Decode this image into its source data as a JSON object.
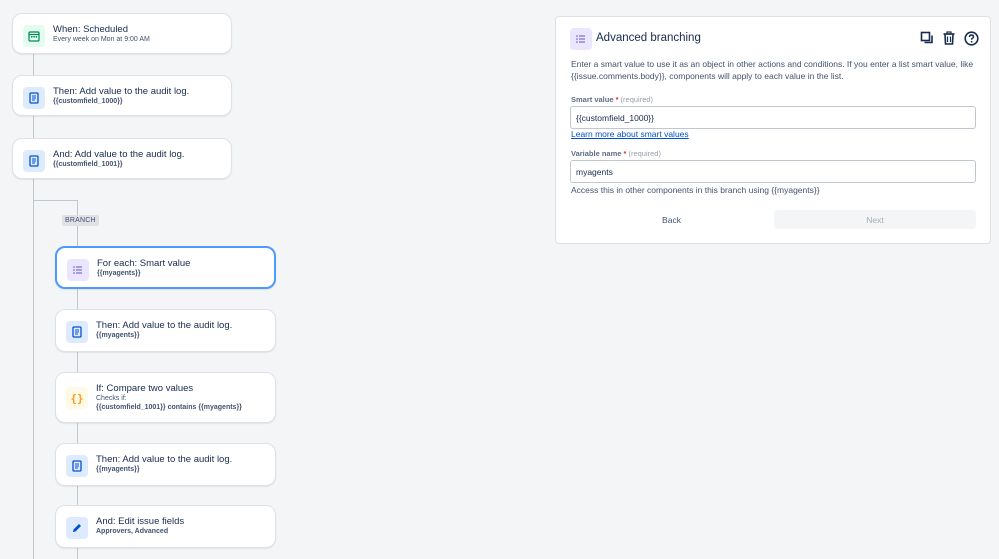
{
  "flow": {
    "trigger": {
      "title": "When: Scheduled",
      "subtitle": "Every week on Mon at 9:00 AM",
      "icon": "calendar-icon"
    },
    "step1": {
      "title": "Then: Add value to the audit log.",
      "subtitle": "{{customfield_1000}}",
      "icon": "document-icon"
    },
    "step2": {
      "title": "And: Add value to the audit log.",
      "subtitle": "{{customfield_1001}}",
      "icon": "document-icon"
    },
    "branch_label": "BRANCH",
    "branch": [
      {
        "title": "For each: Smart value",
        "subtitle": "{{myagents}}",
        "icon": "list-icon"
      },
      {
        "title": "Then: Add value to the audit log.",
        "subtitle": "{{myagents}}",
        "icon": "document-icon"
      },
      {
        "title": "If: Compare two values",
        "subtitle": "Checks if:",
        "subtitle2": "{{customfield_1001}} contains {{myagents}}",
        "icon": "braces-icon"
      },
      {
        "title": "Then: Add value to the audit log.",
        "subtitle": "{{myagents}}",
        "icon": "document-icon"
      },
      {
        "title": "And: Edit issue fields",
        "subtitle": "Approvers, Advanced",
        "icon": "pencil-icon"
      }
    ]
  },
  "panel": {
    "title": "Advanced branching",
    "icon": "list-icon",
    "actions": [
      "copy-icon",
      "trash-icon",
      "help-icon"
    ],
    "description": "Enter a smart value to use it as an object in other actions and conditions. If you enter a list smart value, like {{issue.comments.body}}, components will apply to each value in the list.",
    "smart_value_label": "Smart value",
    "smart_value_required": "(required)",
    "smart_value": "{{customfield_1000}}",
    "learn_more": "Learn more about smart values",
    "variable_label": "Variable name",
    "variable_required": "(required)",
    "variable_value": "myagents",
    "variable_help": "Access this in other components in this branch using {{myagents}}",
    "back_label": "Back",
    "next_label": "Next"
  },
  "colors": {
    "accent": "#0052cc",
    "selected_border": "#4c9aff",
    "required": "#de350b"
  }
}
